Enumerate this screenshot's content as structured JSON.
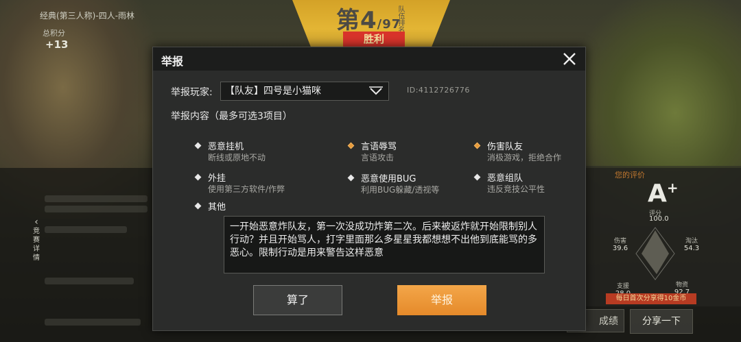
{
  "background": {
    "mode_text": "经典(第三人称)-四人-雨林",
    "total_score_label": "总积分",
    "total_score_value": "+13",
    "rank_prefix": "第",
    "rank_value": "4",
    "rank_total": "/97",
    "rank_sub": "队伍排名",
    "victory": "胜利",
    "side_tab": "竞赛详情",
    "rating": {
      "label": "您的评价",
      "grade": "A",
      "grade_suffix": "+",
      "score_label": "评分",
      "score_value": "100.0",
      "stats": [
        {
          "label": "伤害",
          "value": "39.6"
        },
        {
          "label": "淘汰",
          "value": "54.3"
        },
        {
          "label": "支援",
          "value": "28.0"
        },
        {
          "label": "物资",
          "value": "92.7"
        }
      ]
    },
    "reward_text": "每日首次分享得10金币",
    "share_button": "分享一下",
    "ghost_button": "成绩"
  },
  "dialog": {
    "title": "举报",
    "player_label": "举报玩家:",
    "player_selected": "【队友】四号是小猫咪",
    "player_id": "ID:4112726776",
    "content_label": "举报内容（最多可选3项目）",
    "options": [
      {
        "title": "恶意挂机",
        "desc": "断线或原地不动",
        "checked": false
      },
      {
        "title": "言语辱骂",
        "desc": "言语攻击",
        "checked": true
      },
      {
        "title": "伤害队友",
        "desc": "消极游戏，拒绝合作",
        "checked": true
      },
      {
        "title": "外挂",
        "desc": "使用第三方软件/作弊",
        "checked": false
      },
      {
        "title": "恶意使用BUG",
        "desc": "利用BUG躲藏/透视等",
        "checked": false
      },
      {
        "title": "恶意组队",
        "desc": "违反竞技公平性",
        "checked": false
      },
      {
        "title": "其他",
        "desc": "",
        "checked": false
      }
    ],
    "detail_text": "一开始恶意炸队友，第一次没成功炸第二次。后来被返炸就开始限制别人行动？并且开始骂人，打字里面那么多星星我都想想不出他到底能骂的多恶心。限制行动是用来警告这样恶意",
    "cancel_label": "算了",
    "report_label": "举报"
  },
  "colors": {
    "accent_orange": "#e58a2a",
    "modal_bg": "#2b2c2b",
    "header_bg": "#1c1d1c"
  }
}
